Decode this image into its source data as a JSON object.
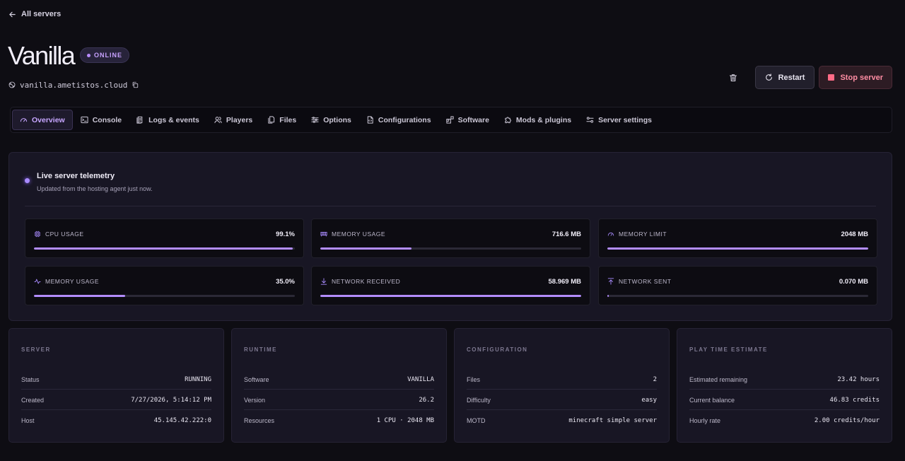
{
  "nav": {
    "back_label": "All servers"
  },
  "server": {
    "name": "Vanilla",
    "status_badge": "ONLINE",
    "hostname": "vanilla.ametistos.cloud"
  },
  "actions": {
    "restart_label": "Restart",
    "stop_label": "Stop server"
  },
  "tabs": [
    {
      "label": "Overview",
      "icon": "gauge-icon",
      "active": true
    },
    {
      "label": "Console",
      "icon": "terminal-icon"
    },
    {
      "label": "Logs & events",
      "icon": "logs-icon"
    },
    {
      "label": "Players",
      "icon": "users-icon"
    },
    {
      "label": "Files",
      "icon": "files-icon"
    },
    {
      "label": "Options",
      "icon": "sliders-icon"
    },
    {
      "label": "Configurations",
      "icon": "file-code-icon"
    },
    {
      "label": "Software",
      "icon": "blocks-icon"
    },
    {
      "label": "Mods & plugins",
      "icon": "puzzle-icon"
    },
    {
      "label": "Server settings",
      "icon": "settings-icon"
    }
  ],
  "telemetry": {
    "title": "Live server telemetry",
    "subtitle": "Updated from the hosting agent just now.",
    "metrics": [
      {
        "label": "CPU USAGE",
        "value": "99.1%",
        "progress": 0.991,
        "icon": "cpu-icon"
      },
      {
        "label": "MEMORY USAGE",
        "value": "716.6 MB",
        "progress": 0.35,
        "icon": "memory-icon"
      },
      {
        "label": "MEMORY LIMIT",
        "value": "2048 MB",
        "progress": 1.0,
        "icon": "gauge-icon"
      },
      {
        "label": "MEMORY USAGE",
        "value": "35.0%",
        "progress": 0.35,
        "icon": "activity-icon"
      },
      {
        "label": "NETWORK RECEIVED",
        "value": "58.969 MB",
        "progress": 1.0,
        "icon": "download-icon"
      },
      {
        "label": "NETWORK SENT",
        "value": "0.070 MB",
        "progress": 0.006,
        "icon": "upload-icon"
      }
    ]
  },
  "cards": [
    {
      "heading": "SERVER",
      "rows": [
        {
          "key": "Status",
          "value": "RUNNING"
        },
        {
          "key": "Created",
          "value": "7/27/2026, 5:14:12 PM"
        },
        {
          "key": "Host",
          "value": "45.145.42.222:0"
        }
      ]
    },
    {
      "heading": "RUNTIME",
      "rows": [
        {
          "key": "Software",
          "value": "VANILLA"
        },
        {
          "key": "Version",
          "value": "26.2"
        },
        {
          "key": "Resources",
          "value": "1 CPU · 2048 MB"
        }
      ]
    },
    {
      "heading": "CONFIGURATION",
      "rows": [
        {
          "key": "Files",
          "value": "2"
        },
        {
          "key": "Difficulty",
          "value": "easy"
        },
        {
          "key": "MOTD",
          "value": "minecraft simple server"
        }
      ]
    },
    {
      "heading": "PLAY TIME ESTIMATE",
      "rows": [
        {
          "key": "Estimated remaining",
          "value": "23.42 hours"
        },
        {
          "key": "Current balance",
          "value": "46.83 credits"
        },
        {
          "key": "Hourly rate",
          "value": "2.00 credits/hour"
        }
      ]
    }
  ],
  "colors": {
    "accent": "#b38dff",
    "background": "#0e0d13",
    "panel": "#181624",
    "danger": "#ff6b86"
  }
}
